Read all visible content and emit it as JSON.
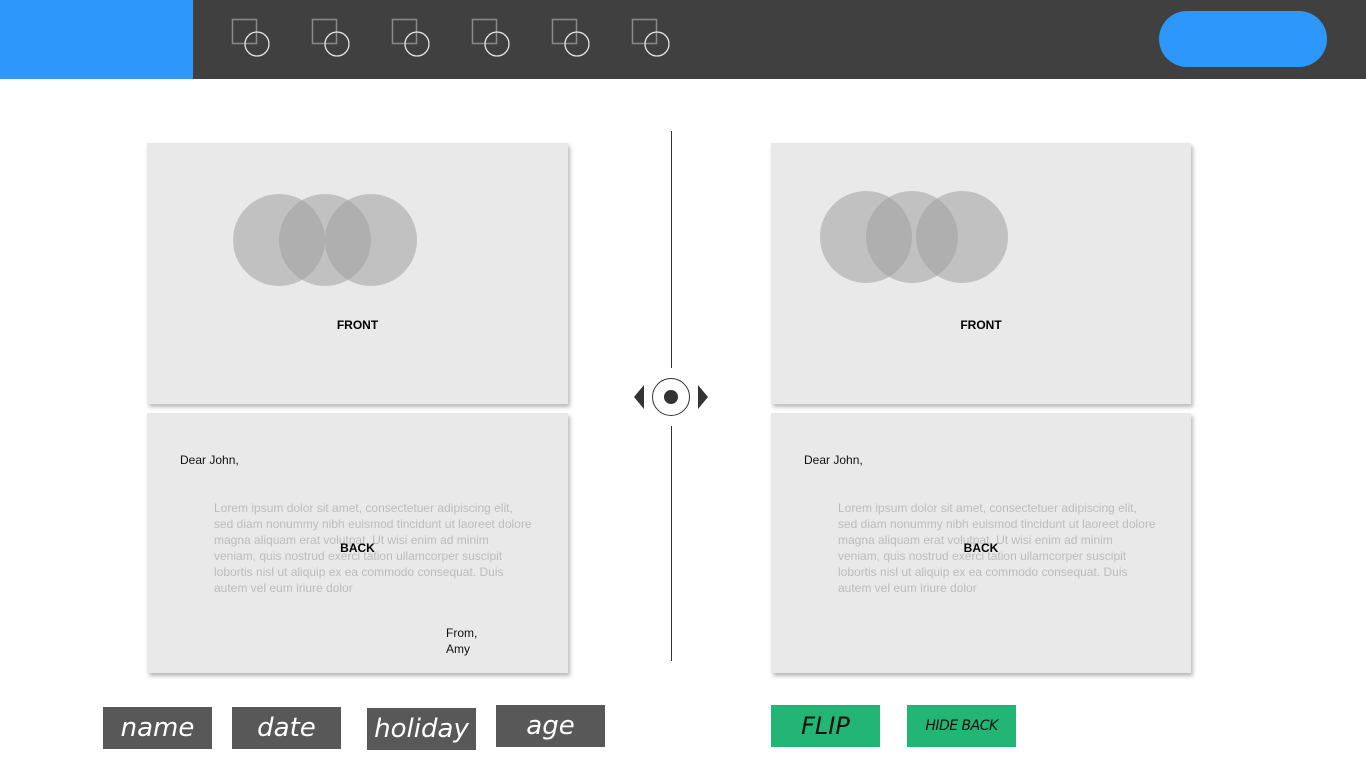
{
  "header": {
    "tools": [
      {
        "icon": "shape-tool-icon"
      },
      {
        "icon": "shape-tool-icon"
      },
      {
        "icon": "shape-tool-icon"
      },
      {
        "icon": "shape-tool-icon"
      },
      {
        "icon": "shape-tool-icon"
      },
      {
        "icon": "shape-tool-icon"
      }
    ],
    "accent_color": "#2d97fb",
    "bar_color": "#404040"
  },
  "cards": {
    "left": {
      "front": {
        "label": "FRONT"
      },
      "back": {
        "label": "BACK",
        "greeting": "Dear John,",
        "body": "Lorem ipsum dolor sit amet, consectetuer adipiscing elit, sed diam nonummy nibh euismod tincidunt ut laoreet dolore magna aliquam erat volutpat. Ut wisi enim ad minim veniam, quis nostrud exerci tation ullamcorper suscipit lobortis nisl ut aliquip ex ea commodo consequat. Duis autem vel eum iriure dolor",
        "signoff_line1": "From,",
        "signoff_line2": "Amy"
      }
    },
    "right": {
      "front": {
        "label": "FRONT"
      },
      "back": {
        "label": "BACK",
        "greeting": "Dear John,",
        "body": "Lorem ipsum dolor sit amet, consectetuer adipiscing elit, sed diam nonummy nibh euismod tincidunt ut laoreet dolore magna aliquam erat volutpat. Ut wisi enim ad minim veniam, quis nostrud exerci tation ullamcorper suscipit lobortis nisl ut aliquip ex ea commodo consequat. Duis autem vel eum iriure dolor"
      }
    }
  },
  "tags": {
    "name": "name",
    "date": "date",
    "holiday": "holiday",
    "age": "age"
  },
  "actions": {
    "flip": "FLIP",
    "hide_back": "HIDE BACK",
    "color": "#22b573"
  }
}
